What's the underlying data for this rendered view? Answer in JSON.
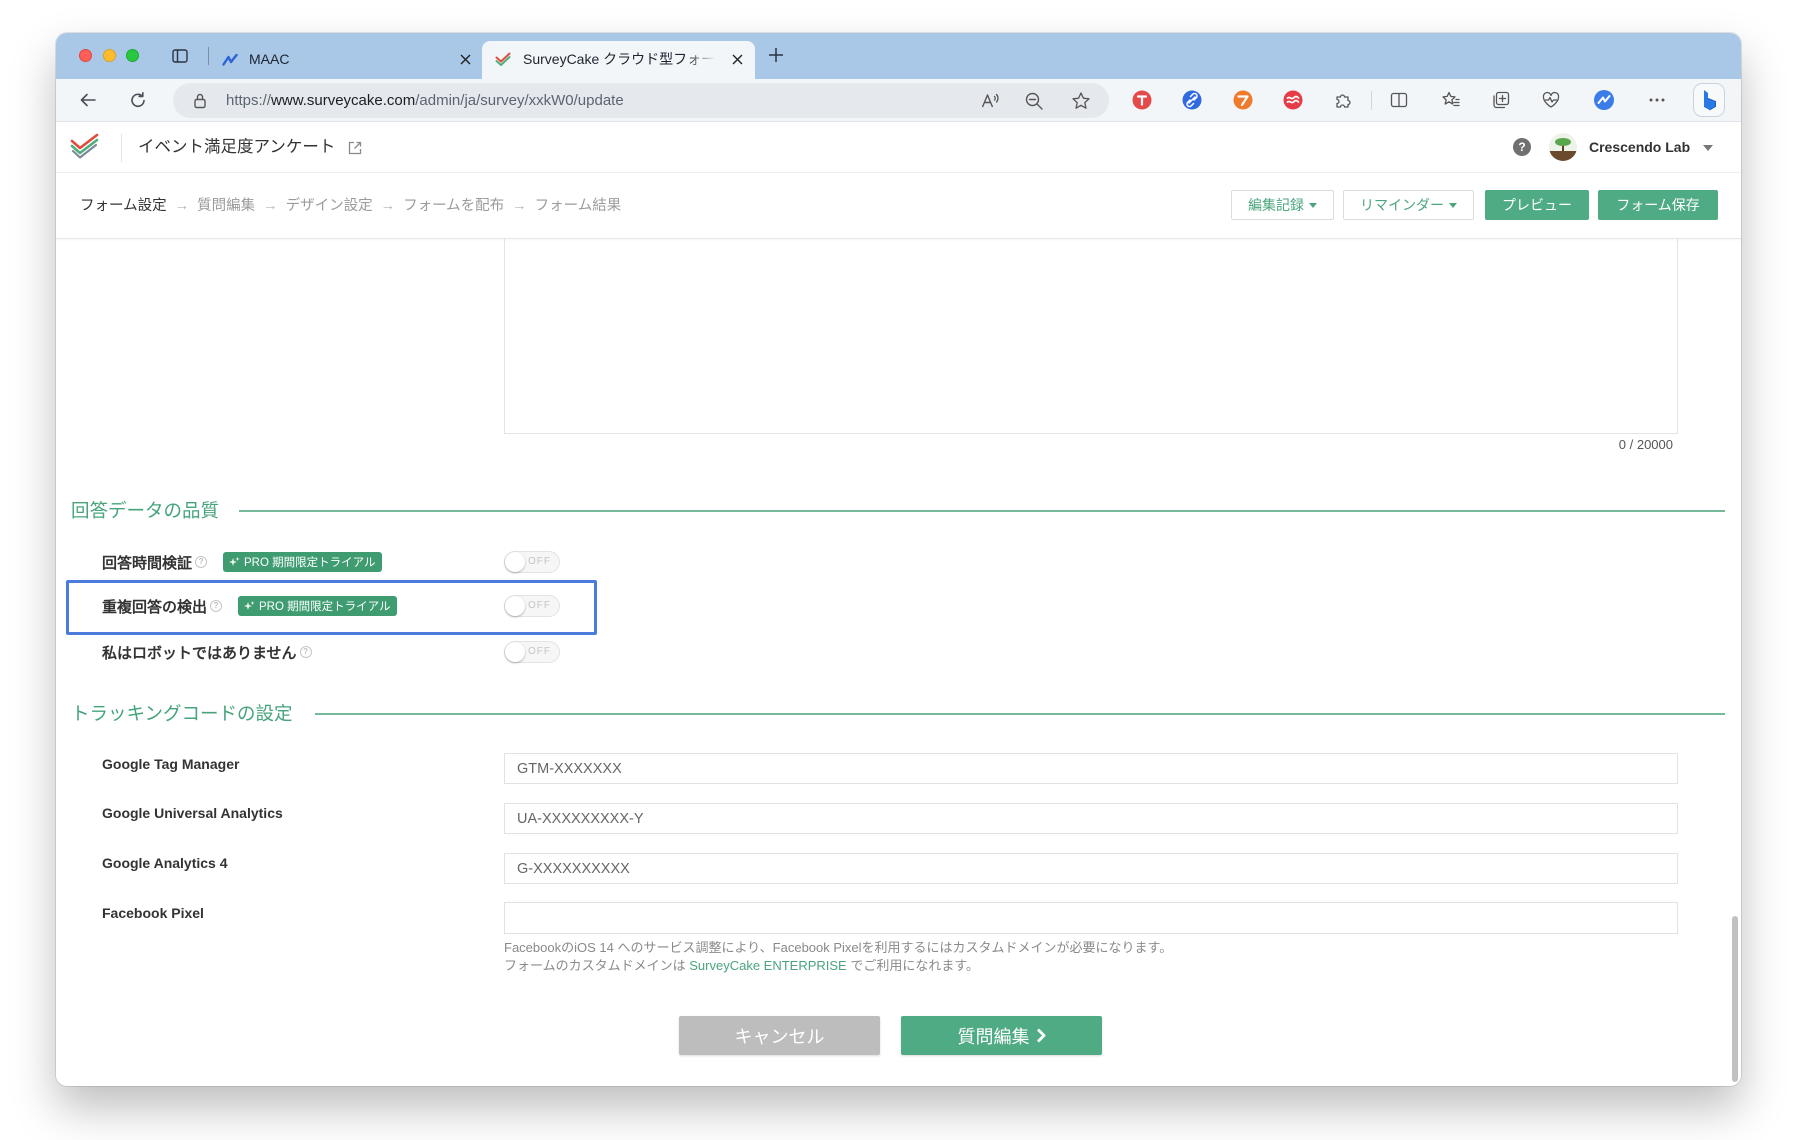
{
  "browser": {
    "tabs": [
      {
        "title": "MAAC",
        "icon": "maac-logo-icon",
        "active": false
      },
      {
        "title": "SurveyCake クラウド型フォーム",
        "icon": "surveycake-logo-icon",
        "active": true
      }
    ],
    "url": {
      "scheme": "https://",
      "host": "www.surveycake.com",
      "path": "/admin/ja/survey/xxkW0/update"
    },
    "toolbar_icons": [
      "read-aloud-icon",
      "zoom-out-icon",
      "favorite-star-icon",
      "red-extension-icon",
      "link-extension-icon",
      "orange-extension-icon",
      "red-wave-extension-icon",
      "extensions-puzzle-icon",
      "split-screen-icon",
      "favorites-icon",
      "collections-icon",
      "browser-essentials-icon",
      "profile-icon",
      "more-options-icon",
      "bing-copilot-icon"
    ],
    "theme": {
      "tab_strip": "#a9c7e6",
      "toolbar": "#f3f6f9"
    }
  },
  "app": {
    "survey_title": "イベント満足度アンケート",
    "user_name": "Crescendo Lab"
  },
  "steps": {
    "items": [
      "フォーム設定",
      "質問編集",
      "デザイン設定",
      "フォームを配布",
      "フォーム結果"
    ],
    "current": 0,
    "separator": "→"
  },
  "actions": {
    "history": "編集記録",
    "reminder": "リマインダー",
    "preview": "プレビュー",
    "save": "フォーム保存"
  },
  "description": {
    "counter": "0 / 20000"
  },
  "quality": {
    "title": "回答データの品質",
    "rows": [
      {
        "label": "回答時間検証",
        "badge": "PRO 期間限定トライアル",
        "toggle": "OFF",
        "highlighted": false
      },
      {
        "label": "重複回答の検出",
        "badge": "PRO 期間限定トライアル",
        "toggle": "OFF",
        "highlighted": true
      },
      {
        "label": "私はロボットではありません",
        "toggle": "OFF",
        "highlighted": false
      }
    ]
  },
  "tracking": {
    "title": "トラッキングコードの設定",
    "fields": [
      {
        "label": "Google Tag Manager",
        "placeholder": "GTM-XXXXXXX"
      },
      {
        "label": "Google Universal Analytics",
        "placeholder": "UA-XXXXXXXXX-Y"
      },
      {
        "label": "Google Analytics 4",
        "placeholder": "G-XXXXXXXXXX"
      },
      {
        "label": "Facebook Pixel"
      }
    ],
    "note": {
      "line1": "FacebookのiOS 14 へのサービス調整により、Facebook Pixelを利用するにはカスタムドメインが必要になります。",
      "line2_prefix": "フォームのカスタムドメインは ",
      "link": "SurveyCake ENTERPRISE",
      "line2_suffix": " でご利用になれます。"
    }
  },
  "footer": {
    "cancel": "キャンセル",
    "next": "質問編集"
  },
  "colors": {
    "accent": "#4fab83",
    "section": "#45a47a",
    "badge": "#3f9c71",
    "highlight": "#4b7bdc",
    "cancel": "#bdbdbd"
  }
}
